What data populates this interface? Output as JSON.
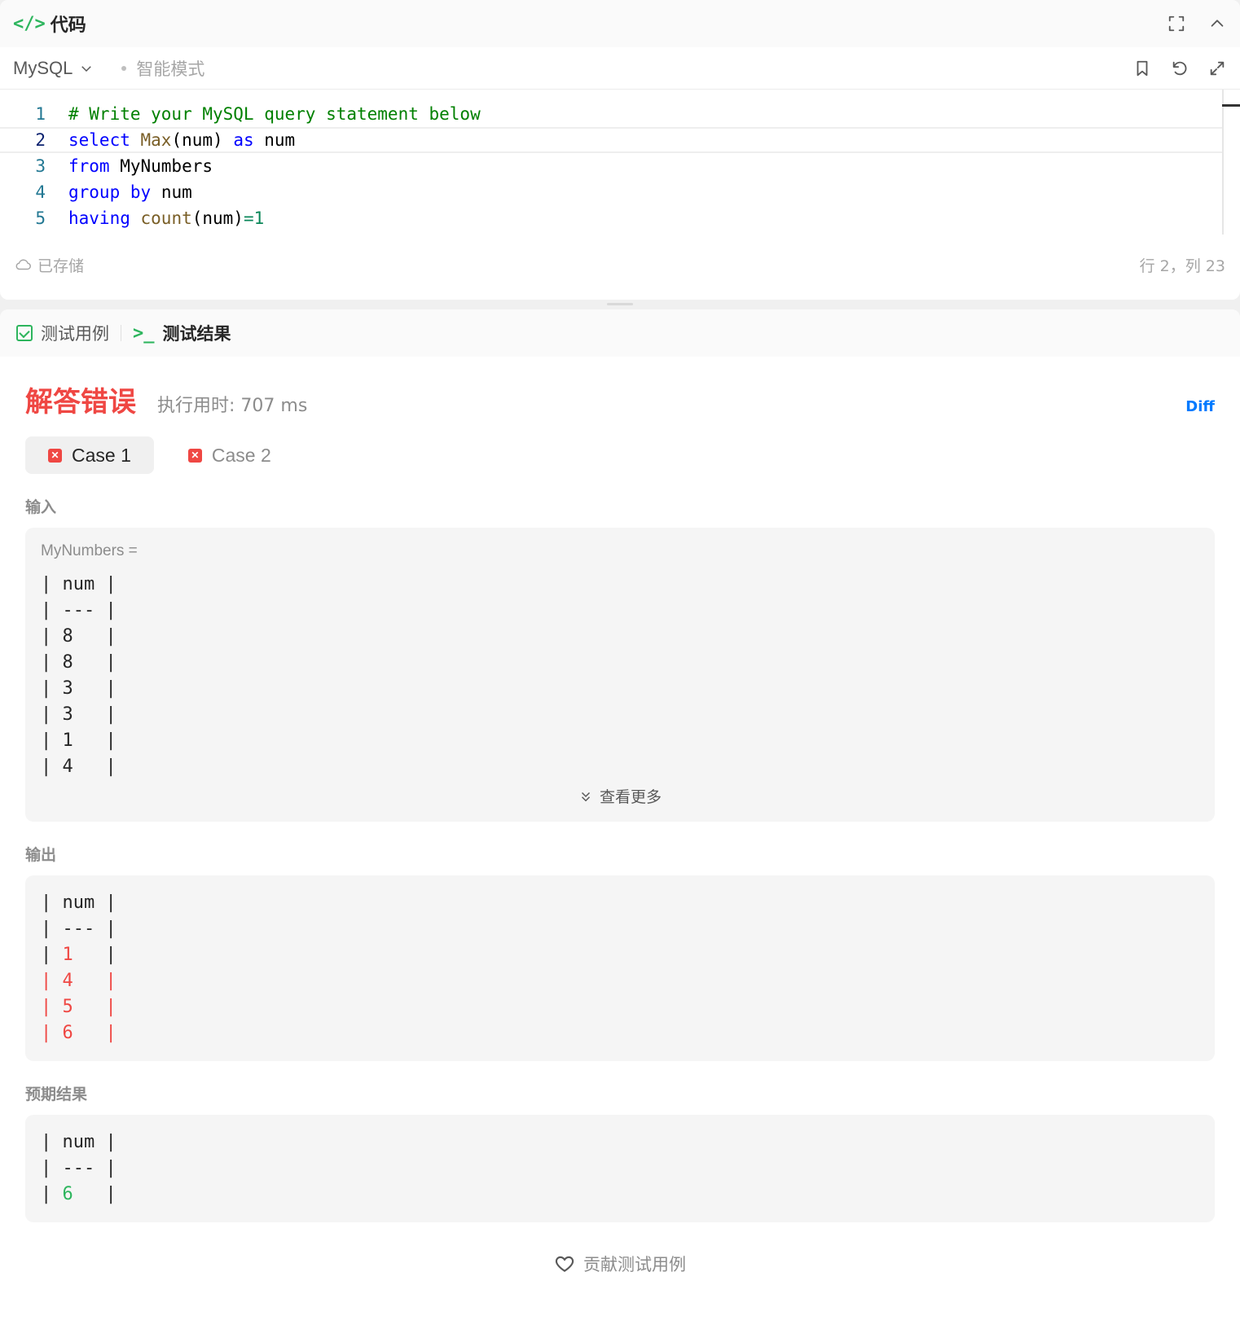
{
  "code_panel": {
    "title_icon": "</>",
    "title": "代码",
    "language": "MySQL",
    "mode": "智能模式",
    "lines": [
      {
        "no": "1"
      },
      {
        "no": "2"
      },
      {
        "no": "3"
      },
      {
        "no": "4"
      },
      {
        "no": "5"
      }
    ],
    "code": {
      "l1": "# Write your MySQL query statement below",
      "l2_kw1": "select",
      "l2_fn": "Max",
      "l2_mid": "(num) ",
      "l2_kw2": "as",
      "l2_end": " num",
      "l3_kw": "from",
      "l3_end": " MyNumbers",
      "l4_kw1": "group",
      "l4_kw2": "by",
      "l4_end": " num",
      "l5_kw": "having",
      "l5_fn": "count",
      "l5_mid": "(num)",
      "l5_op": "=",
      "l5_num": "1"
    },
    "saved_status": "已存储",
    "cursor_position": "行 2，列 23"
  },
  "result_panel": {
    "tabs": [
      {
        "label": "测试用例",
        "active": false
      },
      {
        "label": "测试结果",
        "active": true
      }
    ],
    "term_icon": ">_",
    "verdict": "解答错误",
    "runtime": "执行用时: 707 ms",
    "diff_label": "Diff",
    "cases": [
      {
        "label": "Case 1",
        "active": true,
        "status": "failed"
      },
      {
        "label": "Case 2",
        "active": false,
        "status": "failed"
      }
    ],
    "input_label": "输入",
    "input_var": "MyNumbers =",
    "input_lines": [
      "| num |",
      "| --- |",
      "| 8   |",
      "| 8   |",
      "| 3   |",
      "| 3   |",
      "| 1   |",
      "| 4   |"
    ],
    "more_label": "查看更多",
    "output_label": "输出",
    "output_lines": [
      {
        "text": "| num |",
        "diff": false
      },
      {
        "text": "| --- |",
        "diff": false
      },
      {
        "text": "| 1   |",
        "diff": "partial"
      },
      {
        "text": "| 4   |",
        "diff": true
      },
      {
        "text": "| 5   |",
        "diff": true
      },
      {
        "text": "| 6   |",
        "diff": true
      }
    ],
    "expected_label": "预期结果",
    "expected_lines": [
      "| num |",
      "| --- |",
      "| 6   |"
    ],
    "contribute_label": "贡献测试用例"
  },
  "colors": {
    "accent_green": "#2db55d",
    "error_red": "#ef4743",
    "link_blue": "#007aff"
  },
  "icons": [
    "code-icon",
    "fullscreen-icon",
    "chevron-up-icon",
    "chevron-down-icon",
    "bookmark-icon",
    "reset-icon",
    "expand-icon",
    "cloud-icon",
    "check-square-icon",
    "terminal-icon",
    "x-square-icon",
    "double-chevron-down-icon",
    "heart-icon"
  ]
}
